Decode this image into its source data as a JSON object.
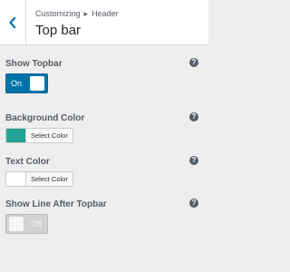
{
  "header": {
    "breadcrumb_parent": "Customizing",
    "breadcrumb_separator": "▸",
    "breadcrumb_section": "Header",
    "title": "Top bar",
    "back_icon": "chevron-left-icon"
  },
  "controls": {
    "show_topbar": {
      "label": "Show Topbar",
      "state": "On",
      "help": "?"
    },
    "background_color": {
      "label": "Background Color",
      "button_label": "Select Color",
      "swatch_color": "#23a596",
      "help": "?"
    },
    "text_color": {
      "label": "Text Color",
      "button_label": "Select Color",
      "swatch_color": "#ffffff",
      "help": "?"
    },
    "show_line_after_topbar": {
      "label": "Show Line After Topbar",
      "state": "Off",
      "help": "?"
    }
  },
  "colors": {
    "accent": "#0073aa",
    "background": "#eeeeee",
    "header_bg": "#ffffff"
  }
}
